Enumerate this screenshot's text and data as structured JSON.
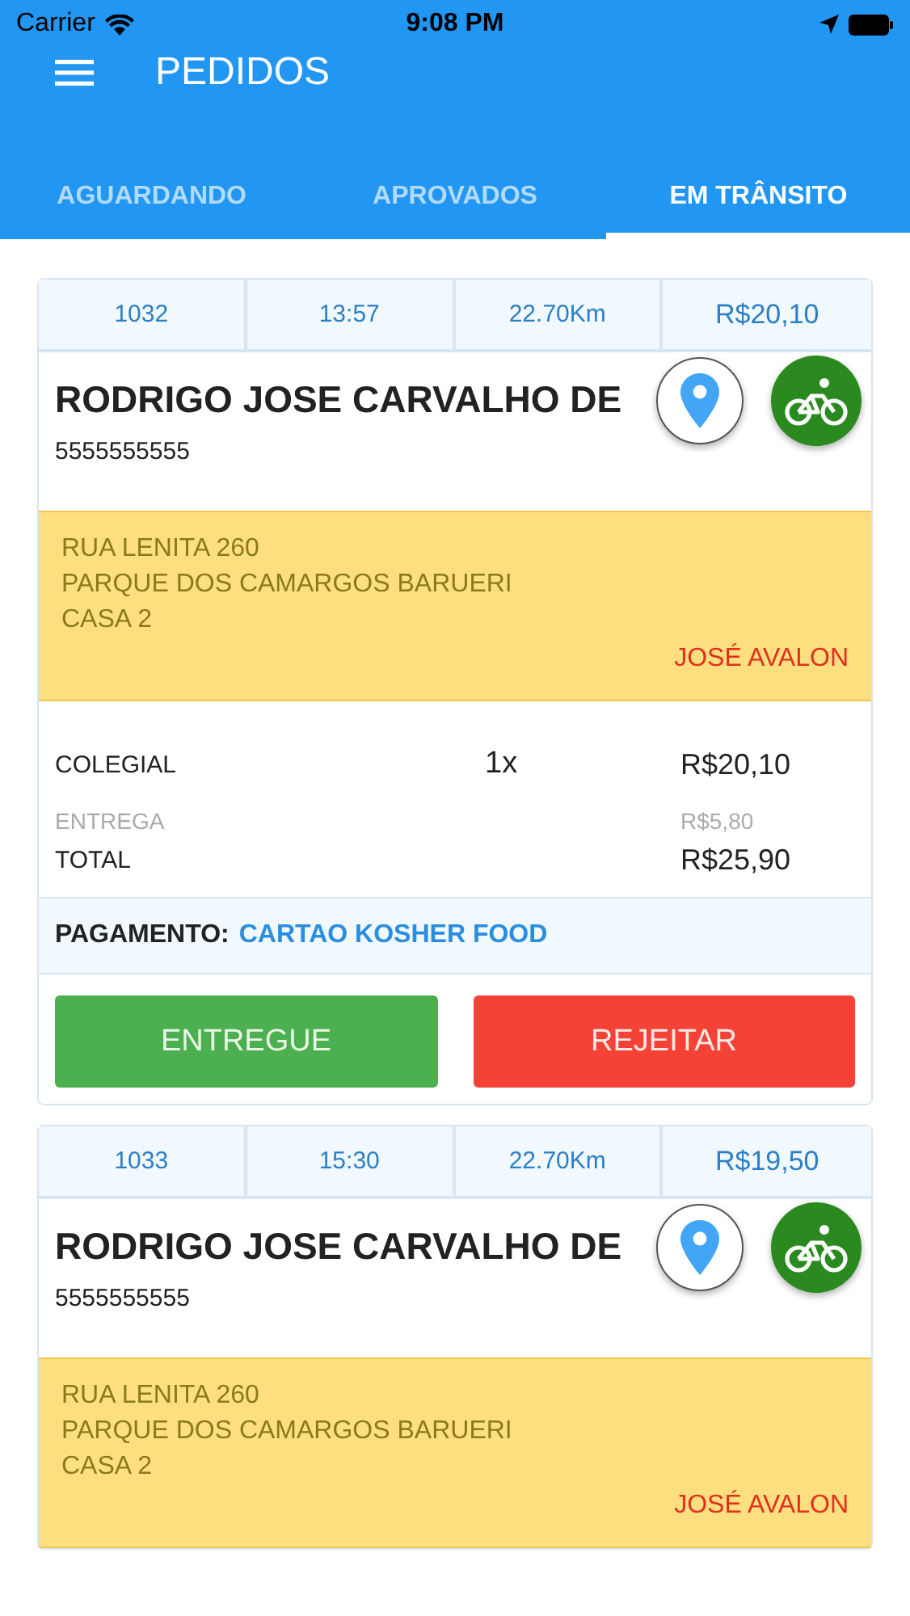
{
  "status_bar": {
    "carrier": "Carrier",
    "time": "9:08 PM"
  },
  "header": {
    "title": "PEDIDOS"
  },
  "tabs": [
    {
      "label": "AGUARDANDO",
      "selected": false
    },
    {
      "label": "APROVADOS",
      "selected": false
    },
    {
      "label": "EM TRÂNSITO",
      "selected": true
    }
  ],
  "orders": [
    {
      "number": "1032",
      "time": "13:57",
      "distance": "22.70Km",
      "price": "R$20,10",
      "customer": "RODRIGO JOSE CARVALHO DE",
      "phone": "5555555555",
      "address": [
        "RUA LENITA 260",
        "PARQUE DOS CAMARGOS BARUERI",
        "CASA 2"
      ],
      "courier": "JOSÉ AVALON",
      "lines": [
        {
          "kind": "item",
          "name": "COLEGIAL",
          "qty": "1x",
          "amount": "R$20,10"
        },
        {
          "kind": "fee",
          "name": "ENTREGA",
          "amount": "R$5,80"
        },
        {
          "kind": "total",
          "name": "TOTAL",
          "amount": "R$25,90"
        }
      ],
      "payment": {
        "label": "PAGAMENTO:",
        "method": "CARTAO KOSHER FOOD"
      },
      "actions": [
        {
          "kind": "accept",
          "label": "ENTREGUE"
        },
        {
          "kind": "reject",
          "label": "REJEITAR"
        }
      ]
    },
    {
      "number": "1033",
      "time": "15:30",
      "distance": "22.70Km",
      "price": "R$19,50",
      "customer": "RODRIGO JOSE CARVALHO DE",
      "phone": "5555555555",
      "address": [
        "RUA LENITA 260",
        "PARQUE DOS CAMARGOS BARUERI",
        "CASA 2"
      ],
      "courier": "JOSÉ AVALON"
    }
  ]
}
